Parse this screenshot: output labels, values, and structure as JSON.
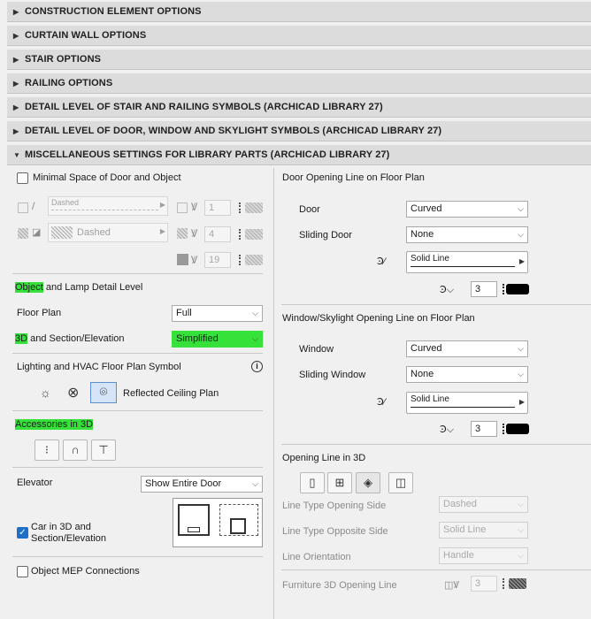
{
  "headers": [
    "CONSTRUCTION ELEMENT OPTIONS",
    "CURTAIN WALL OPTIONS",
    "STAIR OPTIONS",
    "RAILING OPTIONS",
    "DETAIL LEVEL OF STAIR AND RAILING SYMBOLS (ARCHICAD LIBRARY 27)",
    "DETAIL LEVEL OF DOOR, WINDOW AND SKYLIGHT SYMBOLS (ARCHICAD LIBRARY 27)",
    "MISCELLANEOUS SETTINGS FOR LIBRARY PARTS (ARCHICAD LIBRARY 27)"
  ],
  "left": {
    "minimal_space_label": "Minimal Space of Door and Object",
    "line_type_1": "Dashed",
    "line_type_2": "Dashed",
    "pen_1": "1",
    "pen_2": "4",
    "pen_3": "19",
    "object_lamp_title_a": "Object",
    "object_lamp_title_b": " and Lamp Detail Level",
    "floor_plan_label": "Floor Plan",
    "floor_plan_value": "Full",
    "section_label_a": "3D",
    "section_label_b": " and Section/Elevation",
    "section_value": "Simplified",
    "lighting_title": "Lighting and HVAC Floor Plan Symbol",
    "reflected_label": "Reflected Ceiling Plan",
    "accessories_title": "Accessories in 3D",
    "elevator_label": "Elevator",
    "elevator_value": "Show Entire Door",
    "car_label_1": "Car in 3D and",
    "car_label_2": "Section/Elevation",
    "mep_label": "Object MEP Connections"
  },
  "right": {
    "door_title": "Door Opening Line on Floor Plan",
    "door_label": "Door",
    "door_value": "Curved",
    "sliding_door_label": "Sliding Door",
    "sliding_door_value": "None",
    "door_line_type": "Solid Line",
    "door_pen": "3",
    "window_title": "Window/Skylight Opening Line on Floor Plan",
    "window_label": "Window",
    "window_value": "Curved",
    "sliding_window_label": "Sliding Window",
    "sliding_window_value": "None",
    "window_line_type": "Solid Line",
    "window_pen": "3",
    "opening3d_title": "Opening Line in 3D",
    "lt_open_label": "Line Type Opening Side",
    "lt_open_value": "Dashed",
    "lt_opp_label": "Line Type Opposite Side",
    "lt_opp_value": "Solid Line",
    "orient_label": "Line Orientation",
    "orient_value": "Handle",
    "furniture_label": "Furniture 3D Opening Line",
    "furniture_pen": "3"
  },
  "colors": {
    "highlight": "#36e23a",
    "checkbox_on": "#1e6fc8"
  }
}
